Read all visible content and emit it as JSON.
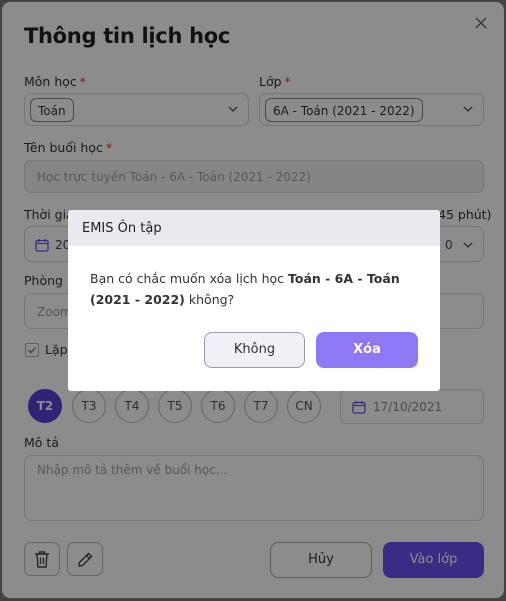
{
  "form": {
    "title": "Thông tin lịch học",
    "subject": {
      "label": "Môn học",
      "required": "*",
      "value": "Toán"
    },
    "class": {
      "label": "Lớp",
      "required": "*",
      "value": "6A - Toán (2021 - 2022)"
    },
    "session_name": {
      "label": "Tên buổi học",
      "required": "*",
      "placeholder": "Học trực tuyến Toán - 6A - Toán (2021 - 2022)"
    },
    "time": {
      "label_partial": "Thời gia",
      "duration_partial": "45 phút)",
      "date_partial": "20",
      "end_partial": "0"
    },
    "room": {
      "label_partial": "Phòng h",
      "value_partial": "Zoom"
    },
    "repeat": {
      "label_partial": "Lặp"
    },
    "days": [
      "T2",
      "T3",
      "T4",
      "T5",
      "T6",
      "T7",
      "CN"
    ],
    "end_date": "17/10/2021",
    "description": {
      "label": "Mô tả",
      "placeholder": "Nhập mô tả thêm về buổi học..."
    },
    "cancel_label": "Hủy",
    "join_label": "Vào lớp"
  },
  "dialog": {
    "title": "EMIS Ôn tập",
    "message_prefix": "Bạn có chắc muốn xóa lịch học ",
    "message_bold": "Toán - 6A - Toán (2021 - 2022)",
    "message_suffix": " không?",
    "no_label": "Không",
    "yes_label": "Xóa"
  },
  "colors": {
    "accent": "#6b4ff0",
    "accent_light": "#8e78f4",
    "required": "#e53935"
  }
}
